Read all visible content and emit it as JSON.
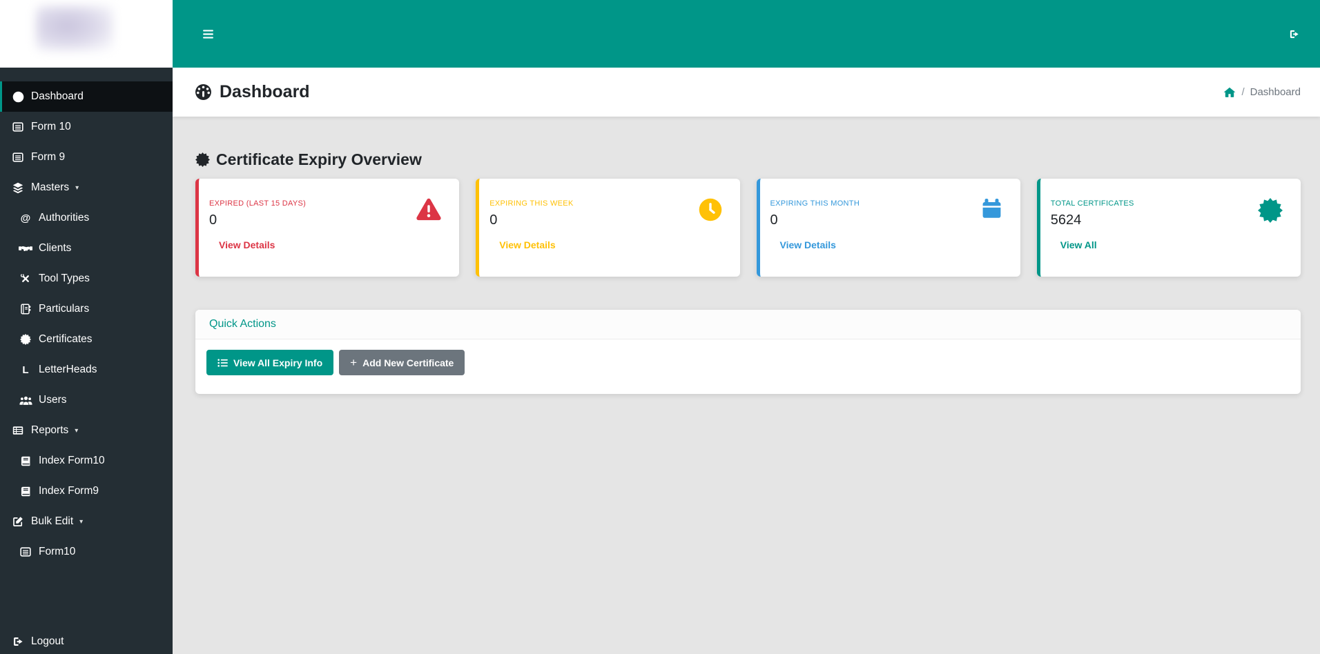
{
  "topbar": {
    "menu_icon": "bars-icon",
    "logout_icon": "sign-out-icon",
    "color": "#009688"
  },
  "sidebar": {
    "background": "#242e34",
    "items": [
      {
        "label": "Dashboard",
        "icon": "speedometer-icon",
        "active": true
      },
      {
        "label": "Form 10",
        "icon": "form-icon"
      },
      {
        "label": "Form 9",
        "icon": "form-icon"
      },
      {
        "label": "Masters",
        "icon": "layers-icon",
        "caret": "▾"
      },
      {
        "label": "Authorities",
        "icon": "at-icon",
        "sub": true
      },
      {
        "label": "Clients",
        "icon": "handshake-icon",
        "sub": true
      },
      {
        "label": "Tool Types",
        "icon": "tools-icon",
        "sub": true
      },
      {
        "label": "Particulars",
        "icon": "address-book-icon",
        "sub": true
      },
      {
        "label": "Certificates",
        "icon": "certificate-icon",
        "sub": true
      },
      {
        "label": "LetterHeads",
        "icon": "letter-l-icon",
        "sub": true
      },
      {
        "label": "Users",
        "icon": "users-icon",
        "sub": true
      },
      {
        "label": "Reports",
        "icon": "table-list-icon",
        "caret": "▾"
      },
      {
        "label": "Index Form10",
        "icon": "book-icon",
        "sub": true
      },
      {
        "label": "Index Form9",
        "icon": "book-icon",
        "sub": true
      },
      {
        "label": "Bulk Edit",
        "icon": "edit-icon",
        "caret": "▾"
      },
      {
        "label": "Form10",
        "icon": "form-icon",
        "sub": true
      }
    ],
    "logout": {
      "label": "Logout",
      "icon": "sign-out-icon"
    }
  },
  "header": {
    "title": "Dashboard",
    "title_icon": "speedometer-icon",
    "breadcrumb": {
      "home_icon": "home-icon",
      "separator": "/",
      "current": "Dashboard"
    }
  },
  "main": {
    "section_title": "Certificate Expiry Overview",
    "section_icon": "certificate-icon",
    "cards": [
      {
        "label": "EXPIRED (LAST 15 DAYS)",
        "value": "0",
        "link_label": "View Details",
        "accent": "#dc3545",
        "icon": "warning-triangle-icon"
      },
      {
        "label": "EXPIRING THIS WEEK",
        "value": "0",
        "link_label": "View Details",
        "accent": "#ffc107",
        "icon": "clock-icon"
      },
      {
        "label": "EXPIRING THIS MONTH",
        "value": "0",
        "link_label": "View Details",
        "accent": "#3498db",
        "icon": "calendar-icon"
      },
      {
        "label": "TOTAL CERTIFICATES",
        "value": "5624",
        "link_label": "View All",
        "accent": "#009688",
        "icon": "certificate-icon"
      }
    ],
    "quick_actions": {
      "title": "Quick Actions",
      "buttons": [
        {
          "label": "View All Expiry Info",
          "icon": "list-ul-icon",
          "color": "#009688"
        },
        {
          "label": "Add New Certificate",
          "icon": "plus-icon",
          "color": "#6c757d"
        }
      ]
    }
  }
}
